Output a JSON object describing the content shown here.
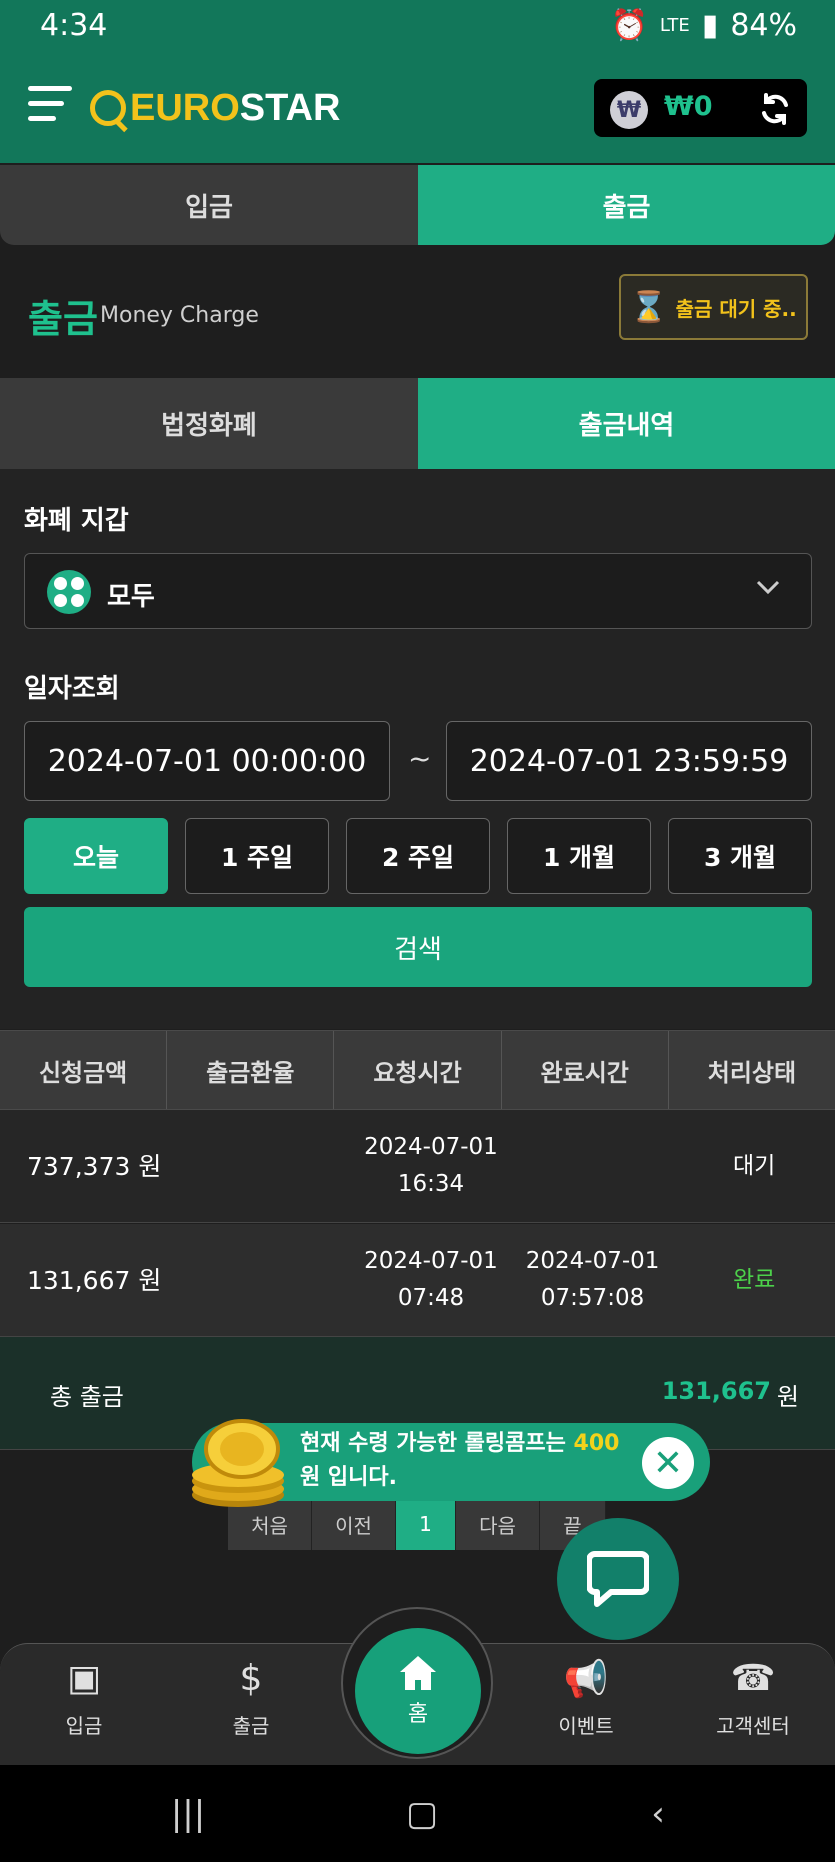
{
  "status_bar": {
    "time": "4:34",
    "battery": "84%",
    "network": "LTE"
  },
  "header": {
    "logo_euro": "EURO",
    "logo_star": "STAR",
    "balance": "₩0"
  },
  "tabs": [
    {
      "label": "입금",
      "active": false
    },
    {
      "label": "출금",
      "active": true
    }
  ],
  "section": {
    "title": "출금",
    "subtitle": "Money Charge",
    "pending_label": "출금 대기 중.."
  },
  "sub_tabs": [
    {
      "label": "법정화폐",
      "active": false
    },
    {
      "label": "출금내역",
      "active": true
    }
  ],
  "wallet": {
    "label": "화폐 지갑",
    "selected": "모두"
  },
  "date": {
    "label": "일자조회",
    "from": "2024-07-01 00:00:00",
    "to": "2024-07-01 23:59:59",
    "separator": "~"
  },
  "ranges": [
    {
      "label": "오늘",
      "active": true
    },
    {
      "label": "1 주일",
      "active": false
    },
    {
      "label": "2 주일",
      "active": false
    },
    {
      "label": "1 개월",
      "active": false
    },
    {
      "label": "3 개월",
      "active": false
    }
  ],
  "search_label": "검색",
  "table": {
    "headers": [
      "신청금액",
      "출금환율",
      "요청시간",
      "완료시간",
      "처리상태"
    ],
    "rows": [
      {
        "amount": "737,373 원",
        "rate": "",
        "requested": "2024-07-01\n16:34",
        "completed": "",
        "status": "대기"
      },
      {
        "amount": "131,667 원",
        "rate": "",
        "requested": "2024-07-01\n07:48",
        "completed": "2024-07-01\n07:57:08",
        "status": "완료"
      }
    ]
  },
  "total": {
    "label": "총 출금",
    "value": "131,667",
    "unit": "원"
  },
  "pagination": {
    "first": "처음",
    "prev": "이전",
    "current": "1",
    "next": "다음",
    "last": "끝"
  },
  "toast": {
    "before": "현재 수령 가능한 롤링콤프는 ",
    "amount": "400",
    "after": " 원 입니다."
  },
  "bottom_nav": [
    {
      "label": "입금",
      "icon": "wallet-in-icon"
    },
    {
      "label": "출금",
      "icon": "hand-coin-icon"
    },
    {
      "label": "홈",
      "icon": "home-icon"
    },
    {
      "label": "이벤트",
      "icon": "megaphone-icon"
    },
    {
      "label": "고객센터",
      "icon": "phone-24-icon"
    }
  ],
  "colors": {
    "accent": "#1fae85",
    "header_bg": "#12775a",
    "gold": "#f2c21b",
    "status_done": "#4cd04a"
  }
}
